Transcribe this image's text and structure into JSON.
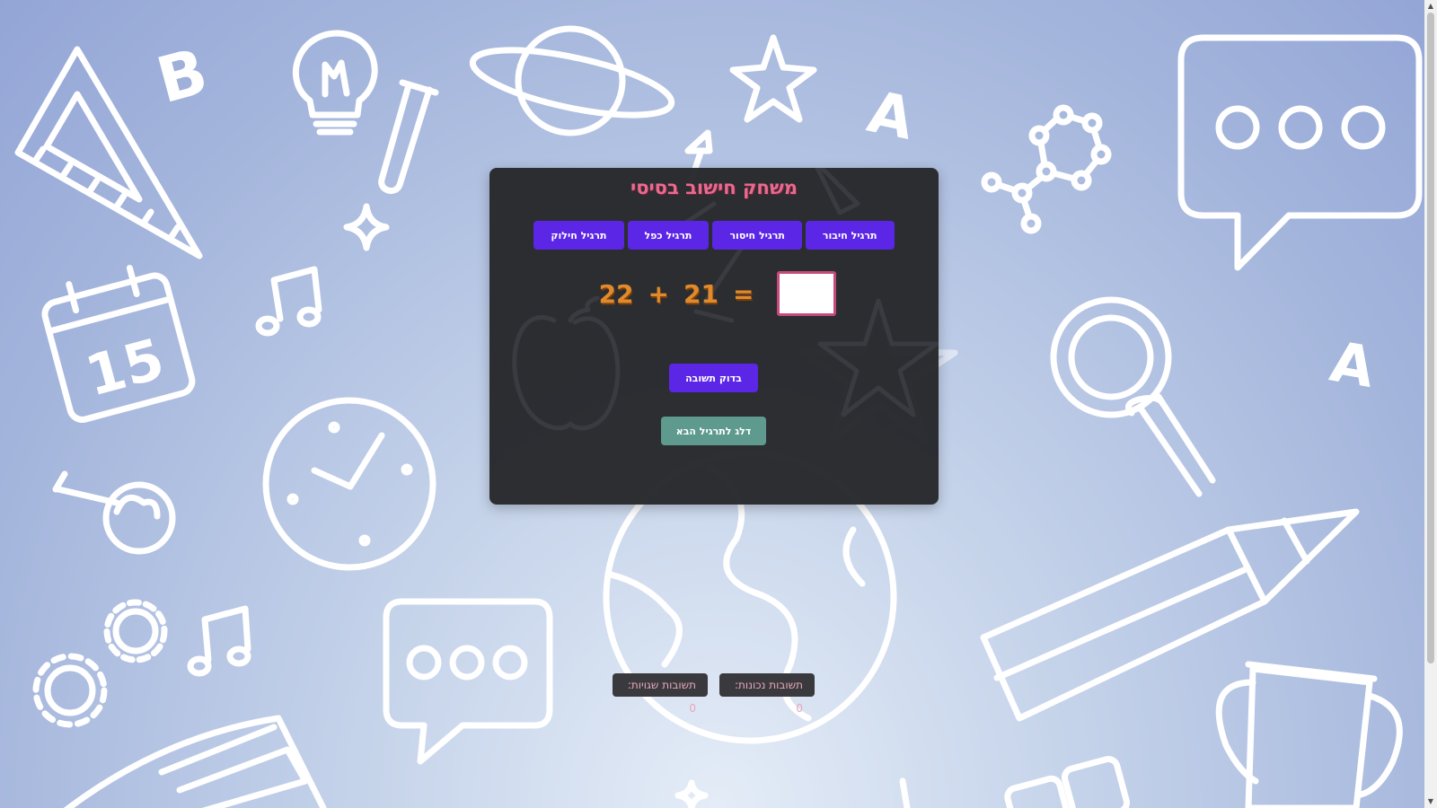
{
  "game": {
    "title": "משחק חישוב בסיסי",
    "modes": [
      {
        "label": "תרגיל חיבור"
      },
      {
        "label": "תרגיל חיסור"
      },
      {
        "label": "תרגיל כפל"
      },
      {
        "label": "תרגיל חילוק"
      }
    ],
    "equation": {
      "left_operand": "22",
      "operator": "+",
      "right_operand": "21",
      "equals": "=",
      "answer_value": ""
    },
    "check_label": "בדוק תשובה",
    "skip_label": "דלג לתרגיל הבא"
  },
  "scores": {
    "correct": "תשובות נכונות: 0",
    "wrong": "תשובות שגויות: 0"
  },
  "background_doodles": {
    "letters": [
      "B",
      "A",
      "A"
    ],
    "calendar_day": "15"
  },
  "colors": {
    "accent_button": "#5b26e5",
    "skip_button": "#5e9a8e",
    "title": "#e86b8e",
    "equation": "#e08a2c",
    "card": "#25262a"
  }
}
